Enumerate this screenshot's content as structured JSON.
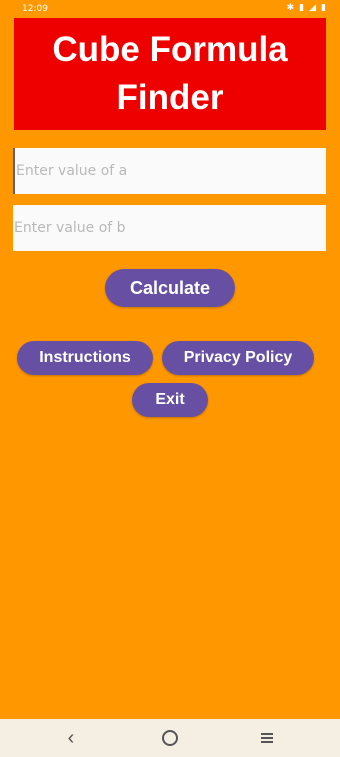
{
  "status_bar": {
    "time": "12:09",
    "icons": [
      "bluetooth-icon",
      "signal-icon",
      "wifi-icon",
      "battery-icon"
    ]
  },
  "header": {
    "title": "Cube Formula Finder"
  },
  "form": {
    "a_placeholder": "Enter value of a",
    "a_value": "",
    "b_placeholder": "Enter value of b",
    "b_value": ""
  },
  "buttons": {
    "calculate": "Calculate",
    "instructions": "Instructions",
    "privacy": "Privacy Policy",
    "exit": "Exit"
  },
  "nav_bar": {
    "icons": [
      "back-icon",
      "home-icon",
      "recents-icon"
    ]
  },
  "colors": {
    "background": "#FF9800",
    "header": "#EE0000",
    "button": "#6750A4"
  }
}
